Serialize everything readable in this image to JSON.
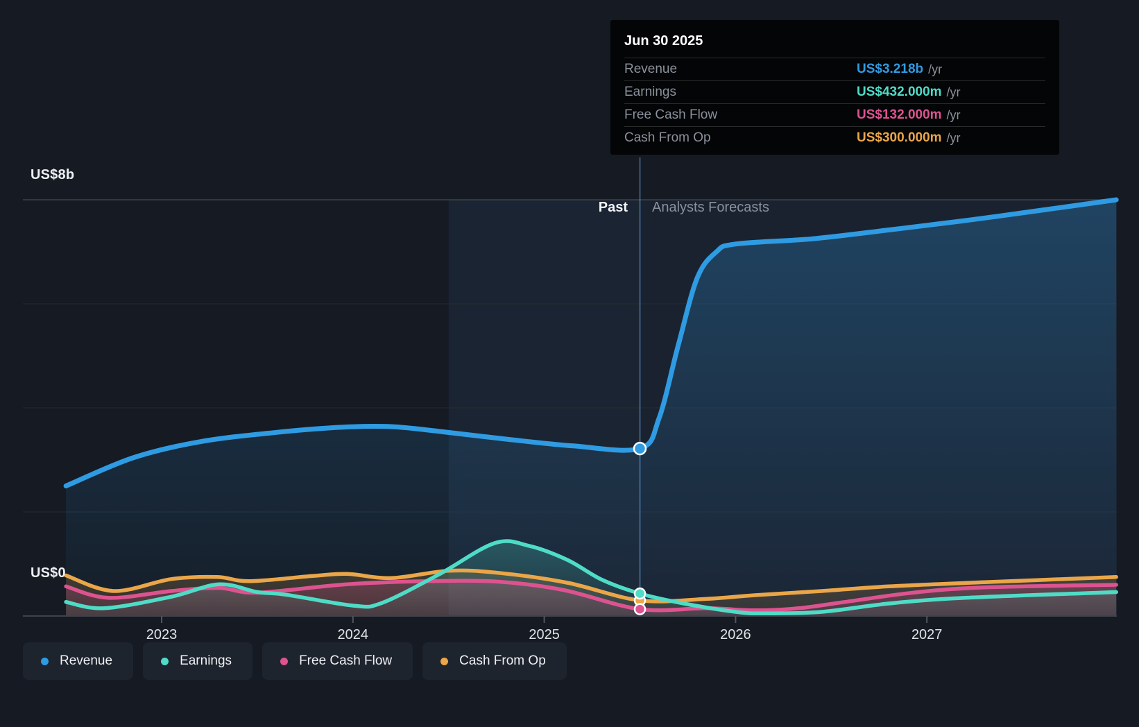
{
  "tooltip": {
    "date": "Jun 30 2025",
    "unit": "/yr",
    "rows": [
      {
        "label": "Revenue",
        "value": "US$3.218b",
        "key": "revenue"
      },
      {
        "label": "Earnings",
        "value": "US$432.000m",
        "key": "earnings"
      },
      {
        "label": "Free Cash Flow",
        "value": "US$132.000m",
        "key": "fcf"
      },
      {
        "label": "Cash From Op",
        "value": "US$300.000m",
        "key": "cashop"
      }
    ]
  },
  "labels": {
    "past": "Past",
    "forecasts": "Analysts Forecasts"
  },
  "axis": {
    "y_top": "US$8b",
    "y_zero": "US$0",
    "years": [
      "2023",
      "2024",
      "2025",
      "2026",
      "2027"
    ]
  },
  "legend": [
    {
      "label": "Revenue",
      "key": "revenue"
    },
    {
      "label": "Earnings",
      "key": "earnings"
    },
    {
      "label": "Free Cash Flow",
      "key": "fcf"
    },
    {
      "label": "Cash From Op",
      "key": "cashop"
    }
  ],
  "colors": {
    "revenue": "#2f9be2",
    "earnings": "#4fdcc7",
    "fcf": "#dd5390",
    "cashop": "#eaa648",
    "background": "#151a23",
    "tooltip_bg": "#040507",
    "grid_strong": "#3e434b",
    "grid_faint": "#262b33",
    "tick": "#51565e",
    "muted_text": "#8b919b",
    "bright_text": "#eef0f3",
    "divider": "rgba(100,155,215,0.5)",
    "forecast_overlay": "rgba(84,136,200,0.08)",
    "band_overlay": "rgba(84,140,210,0.09)"
  },
  "chart_data": {
    "type": "line",
    "title": "Earnings and Revenue Growth",
    "unit": "US$ billions per year",
    "xlim": [
      2022.27,
      2028.0
    ],
    "ylim": [
      0,
      8
    ],
    "x_ticks": [
      2023,
      2024,
      2025,
      2026,
      2027
    ],
    "y_gridlines": [
      2,
      4,
      6,
      8
    ],
    "divider_x": 2025.5,
    "marker_date_x": 2025.5,
    "zones": {
      "band_start": 2024.5,
      "band_end": 2025.5,
      "forecast_end": 2028.0
    },
    "legend_position": "bottom-left",
    "grid": true,
    "series": [
      {
        "name": "Revenue",
        "key": "revenue",
        "marker_value": 3.218,
        "line_width": 7,
        "points": [
          [
            2022.5,
            2.5
          ],
          [
            2022.85,
            3.04
          ],
          [
            2023.2,
            3.35
          ],
          [
            2023.6,
            3.53
          ],
          [
            2023.95,
            3.63
          ],
          [
            2024.2,
            3.64
          ],
          [
            2024.45,
            3.55
          ],
          [
            2024.8,
            3.4
          ],
          [
            2025.15,
            3.27
          ],
          [
            2025.5,
            3.218
          ],
          [
            2025.6,
            3.8
          ],
          [
            2025.7,
            5.2
          ],
          [
            2025.8,
            6.5
          ],
          [
            2025.9,
            7.0
          ],
          [
            2026.0,
            7.15
          ],
          [
            2026.4,
            7.25
          ],
          [
            2026.8,
            7.42
          ],
          [
            2027.2,
            7.6
          ],
          [
            2027.6,
            7.8
          ],
          [
            2027.99,
            8.0
          ]
        ],
        "fill_alpha": [
          0.28,
          0.03
        ]
      },
      {
        "name": "Cash From Op",
        "key": "cashop",
        "marker_value": 0.3,
        "line_width": 5.5,
        "points": [
          [
            2022.5,
            0.78
          ],
          [
            2022.75,
            0.48
          ],
          [
            2023.05,
            0.71
          ],
          [
            2023.29,
            0.75
          ],
          [
            2023.46,
            0.67
          ],
          [
            2023.79,
            0.77
          ],
          [
            2023.97,
            0.81
          ],
          [
            2024.2,
            0.73
          ],
          [
            2024.5,
            0.87
          ],
          [
            2024.76,
            0.83
          ],
          [
            2025.12,
            0.64
          ],
          [
            2025.5,
            0.3
          ],
          [
            2025.85,
            0.33
          ],
          [
            2026.1,
            0.4
          ],
          [
            2026.45,
            0.48
          ],
          [
            2026.8,
            0.57
          ],
          [
            2027.3,
            0.65
          ],
          [
            2027.99,
            0.75
          ]
        ],
        "fill_alpha": [
          0.2,
          0.12
        ]
      },
      {
        "name": "Free Cash Flow",
        "key": "fcf",
        "marker_value": 0.132,
        "line_width": 5.5,
        "points": [
          [
            2022.5,
            0.57
          ],
          [
            2022.72,
            0.35
          ],
          [
            2023.05,
            0.48
          ],
          [
            2023.3,
            0.54
          ],
          [
            2023.5,
            0.45
          ],
          [
            2023.97,
            0.61
          ],
          [
            2024.4,
            0.67
          ],
          [
            2024.76,
            0.66
          ],
          [
            2025.1,
            0.5
          ],
          [
            2025.5,
            0.132
          ],
          [
            2025.85,
            0.15
          ],
          [
            2026.1,
            0.11
          ],
          [
            2026.33,
            0.15
          ],
          [
            2026.57,
            0.27
          ],
          [
            2026.93,
            0.45
          ],
          [
            2027.3,
            0.55
          ],
          [
            2027.99,
            0.6
          ]
        ],
        "fill_alpha": [
          0.24,
          0.14
        ]
      },
      {
        "name": "Earnings",
        "key": "earnings",
        "marker_value": 0.432,
        "line_width": 5.5,
        "points": [
          [
            2022.5,
            0.27
          ],
          [
            2022.7,
            0.15
          ],
          [
            2023.05,
            0.37
          ],
          [
            2023.3,
            0.61
          ],
          [
            2023.5,
            0.46
          ],
          [
            2023.65,
            0.41
          ],
          [
            2024.0,
            0.2
          ],
          [
            2024.15,
            0.25
          ],
          [
            2024.45,
            0.8
          ],
          [
            2024.74,
            1.4
          ],
          [
            2024.92,
            1.35
          ],
          [
            2025.12,
            1.08
          ],
          [
            2025.3,
            0.7
          ],
          [
            2025.5,
            0.432
          ],
          [
            2025.73,
            0.24
          ],
          [
            2026.0,
            0.08
          ],
          [
            2026.15,
            0.05
          ],
          [
            2026.45,
            0.08
          ],
          [
            2026.8,
            0.24
          ],
          [
            2027.2,
            0.35
          ],
          [
            2027.99,
            0.46
          ]
        ],
        "fill_alpha": [
          0.25,
          0.05
        ]
      }
    ]
  }
}
